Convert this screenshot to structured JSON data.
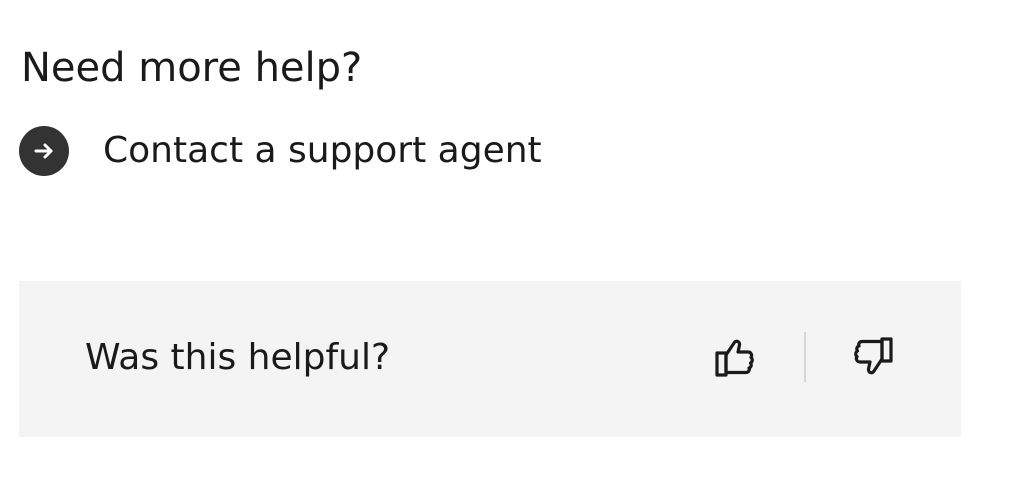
{
  "help": {
    "heading": "Need more help?",
    "contact_link": {
      "label": "Contact a support agent",
      "icon": "arrow-right-circle-icon"
    }
  },
  "feedback": {
    "question": "Was this helpful?",
    "thumbs_up_icon": "thumbs-up-icon",
    "thumbs_down_icon": "thumbs-down-icon"
  },
  "colors": {
    "text": "#1a1a1a",
    "icon_circle": "#333333",
    "panel_background": "#f4f4f4",
    "divider": "#d6d6d6"
  }
}
